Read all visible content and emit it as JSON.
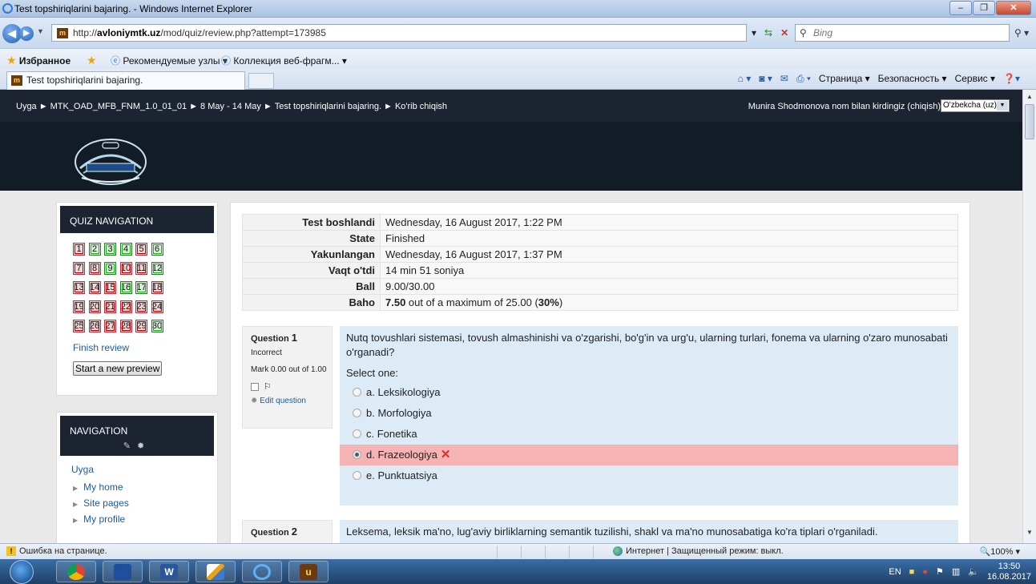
{
  "window": {
    "title": "Test topshiriqlarini bajaring. - Windows Internet Explorer",
    "url_prefix": "http://",
    "url_host": "avloniymtk.uz",
    "url_path": "/mod/quiz/review.php?attempt=173985",
    "search_placeholder": "Bing",
    "favorites_label": "Избранное",
    "fav_item1": "Рекомендуемые узлы ▾",
    "fav_item2": "Коллекция веб-фрагм... ▾",
    "tab_title": "Test topshiriqlarini bajaring.",
    "cmd_page": "Страница ▾",
    "cmd_security": "Безопасность ▾",
    "cmd_service": "Сервис ▾"
  },
  "topnav": {
    "breadcrumbs": [
      "Uyga",
      "MTK_OAD_MFB_FNM_1.0_01_01",
      "8 May - 14 May",
      "Test topshiriqlarini bajaring.",
      "Ko'rib chiqish"
    ],
    "separator": "►",
    "login_info": "Munira Shodmonova nom bilan kirdingiz (chiqish)",
    "language": "O'zbekcha (uz)"
  },
  "quiz_nav": {
    "title": "QUIZ NAVIGATION",
    "states": [
      "r",
      "g",
      "g",
      "g",
      "r",
      "g",
      "r",
      "r",
      "g",
      "r",
      "r",
      "g",
      "r",
      "r",
      "r",
      "g",
      "g",
      "r",
      "r",
      "r",
      "r",
      "r",
      "r",
      "r",
      "r",
      "r",
      "r",
      "r",
      "r",
      "g"
    ],
    "finish_review": "Finish review",
    "start_new_preview": "Start a new preview"
  },
  "navigation": {
    "title": "NAVIGATION",
    "home": "Uyga",
    "items": [
      "My home",
      "Site pages",
      "My profile"
    ]
  },
  "summary": {
    "rows": [
      {
        "k": "Test boshlandi",
        "v": "Wednesday, 16 August 2017, 1:22 PM"
      },
      {
        "k": "State",
        "v": "Finished"
      },
      {
        "k": "Yakunlangan",
        "v": "Wednesday, 16 August 2017, 1:37 PM"
      },
      {
        "k": "Vaqt o'tdi",
        "v": "14 min 51 soniya"
      },
      {
        "k": "Ball",
        "v": "9.00/30.00"
      }
    ],
    "baho_key": "Baho",
    "baho_grade": "7.50",
    "baho_mid": " out of a maximum of 25.00 (",
    "baho_pct": "30%",
    "baho_end": ")"
  },
  "question1": {
    "label": "Question",
    "number": "1",
    "state": "Incorrect",
    "mark": "Mark 0.00 out of 1.00",
    "edit": "Edit question",
    "text": "Nutq tovushlari sistemasi, tovush almashinishi va o'zgarishi, bo'g'in va urg'u, ularning turlari, fonema va ularning o'zaro munosabati o'rganadi?",
    "select_one": "Select one:",
    "options": [
      "a. Leksikologiya",
      "b. Morfologiya",
      "c. Fonetika",
      "d. Frazeologiya",
      "e. Punktuatsiya"
    ],
    "selected_index": 3
  },
  "question2": {
    "label": "Question",
    "number": "2",
    "text": "Leksema, leksik ma'no, lug'aviy birliklarning semantik tuzilishi, shakl va ma'no munosabatiga ko'ra tiplari o'rganiladi."
  },
  "statusbar": {
    "error": "Ошибка на странице.",
    "zone": "Интернет | Защищенный режим: выкл.",
    "zoom": "100%"
  },
  "taskbar": {
    "lang": "EN",
    "time": "13:50",
    "date": "16.08.2017"
  }
}
